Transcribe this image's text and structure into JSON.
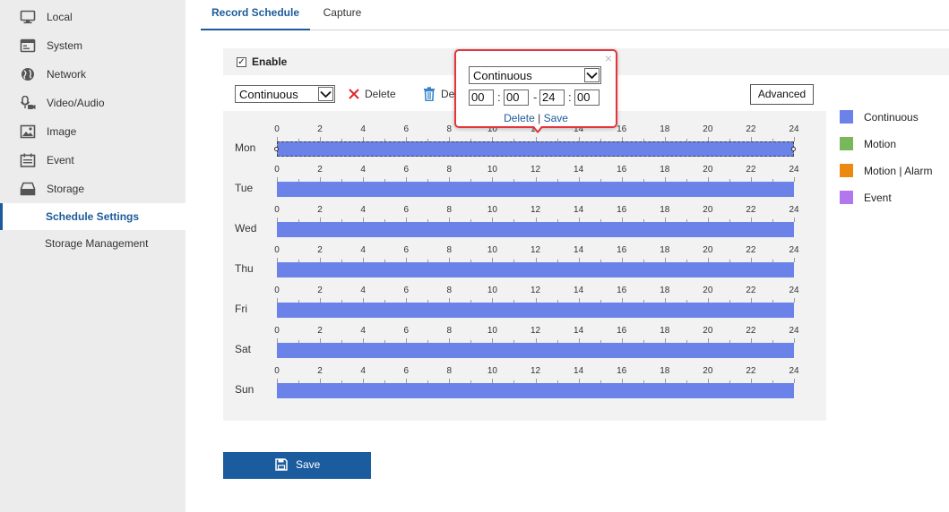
{
  "sidebar": {
    "items": [
      {
        "label": "Local",
        "icon": "monitor-icon"
      },
      {
        "label": "System",
        "icon": "system-window-icon"
      },
      {
        "label": "Network",
        "icon": "globe-icon"
      },
      {
        "label": "Video/Audio",
        "icon": "microphone-camera-icon"
      },
      {
        "label": "Image",
        "icon": "image-icon"
      },
      {
        "label": "Event",
        "icon": "calendar-icon"
      },
      {
        "label": "Storage",
        "icon": "storage-icon"
      }
    ],
    "sub_items": [
      {
        "label": "Schedule Settings",
        "active": true
      },
      {
        "label": "Storage Management",
        "active": false
      }
    ]
  },
  "tabs": [
    {
      "label": "Record Schedule",
      "active": true
    },
    {
      "label": "Capture",
      "active": false
    }
  ],
  "enable": {
    "label": "Enable",
    "checked": true
  },
  "toolbar": {
    "mode_value": "Continuous",
    "delete_label": "Delete",
    "delete_all_label": "Delete All",
    "advanced_label": "Advanced"
  },
  "schedule": {
    "days": [
      "Mon",
      "Tue",
      "Wed",
      "Thu",
      "Fri",
      "Sat",
      "Sun"
    ],
    "hour_ticks": [
      "0",
      "2",
      "4",
      "6",
      "8",
      "10",
      "12",
      "14",
      "16",
      "18",
      "20",
      "22",
      "24"
    ],
    "bar_color": "#6b82e8",
    "selected_day": "Mon",
    "segments": [
      {
        "day": "Mon",
        "start": 0,
        "end": 24,
        "type": "Continuous"
      },
      {
        "day": "Tue",
        "start": 0,
        "end": 24,
        "type": "Continuous"
      },
      {
        "day": "Wed",
        "start": 0,
        "end": 24,
        "type": "Continuous"
      },
      {
        "day": "Thu",
        "start": 0,
        "end": 24,
        "type": "Continuous"
      },
      {
        "day": "Fri",
        "start": 0,
        "end": 24,
        "type": "Continuous"
      },
      {
        "day": "Sat",
        "start": 0,
        "end": 24,
        "type": "Continuous"
      },
      {
        "day": "Sun",
        "start": 0,
        "end": 24,
        "type": "Continuous"
      }
    ]
  },
  "legend": [
    {
      "label": "Continuous",
      "color": "#6b82e8"
    },
    {
      "label": "Motion",
      "color": "#79b85a"
    },
    {
      "label": "Motion | Alarm",
      "color": "#ea8a12"
    },
    {
      "label": "Event",
      "color": "#b277ec"
    }
  ],
  "popup": {
    "type_value": "Continuous",
    "start_hour": "00",
    "start_minute": "00",
    "end_hour": "24",
    "end_minute": "00",
    "colon": ":",
    "dash": "-",
    "delete_label": "Delete",
    "separator": "|",
    "save_label": "Save",
    "close_glyph": "×"
  },
  "save_button": {
    "label": "Save"
  }
}
